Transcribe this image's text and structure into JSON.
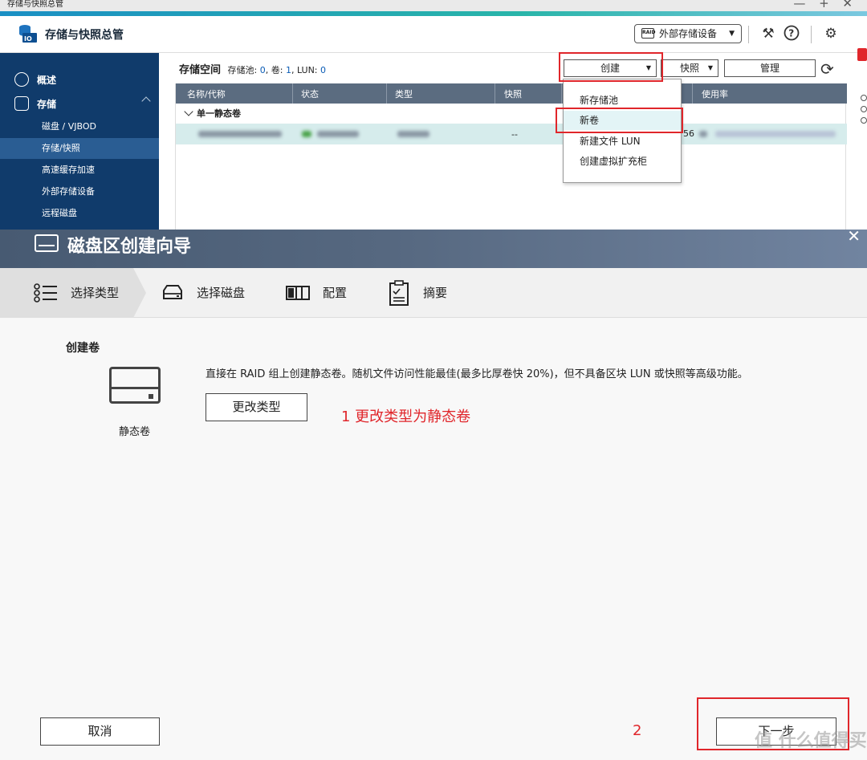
{
  "window": {
    "title": "存储与快照总管",
    "controls": "—  +  ✕"
  },
  "app": {
    "title": "存储与快照总管",
    "external_devices_label": "外部存储设备",
    "raid_badge": "RAID",
    "icons": [
      "tools-icon",
      "help-icon",
      "settings-icon"
    ]
  },
  "sidebar": {
    "sections": [
      {
        "label": "概述",
        "icon": "dashboard-icon"
      },
      {
        "label": "存储",
        "icon": "storage-icon"
      }
    ],
    "items": [
      {
        "label": "磁盘 / VJBOD",
        "active": false
      },
      {
        "label": "存储/快照",
        "active": true
      },
      {
        "label": "高速缓存加速",
        "active": false
      },
      {
        "label": "外部存储设备",
        "active": false
      },
      {
        "label": "远程磁盘",
        "active": false
      }
    ]
  },
  "content": {
    "title": "存储空间",
    "meta_prefix": "存储池: ",
    "pool_count": "0",
    "meta_vol": ", 卷: ",
    "vol_count": "1",
    "meta_lun": ", LUN: ",
    "lun_count": "0",
    "toolbar": {
      "create": "创建",
      "snapshot": "快照",
      "manage": "管理"
    },
    "columns": [
      "名称/代称",
      "状态",
      "类型",
      "快照",
      "",
      "使用率"
    ],
    "group_label": "单一静态卷",
    "row": {
      "snapshot": "--",
      "partial_capacity": "56"
    }
  },
  "create_menu": {
    "items": [
      "新存储池",
      "新卷",
      "新建文件 LUN",
      "创建虚拟扩充柜"
    ],
    "highlighted": 1
  },
  "wizard": {
    "title": "磁盘区创建向导",
    "steps": [
      "选择类型",
      "选择磁盘",
      "配置",
      "摘要"
    ],
    "active_step": 0,
    "section_label": "创建卷",
    "volume_type": "静态卷",
    "description": "直接在 RAID 组上创建静态卷。随机文件访问性能最佳(最多比厚卷快 20%)，但不具备区块 LUN 或快照等高级功能。",
    "change_type_button": "更改类型",
    "cancel_button": "取消",
    "next_button": "下一步"
  },
  "annotations": {
    "step1": "1 更改类型为静态卷",
    "step2": "2"
  },
  "watermark": "值 什么值得买",
  "colors": {
    "sidebar_bg": "#103b6b",
    "sidebar_active": "#2a5d93",
    "table_header": "#5b6c80",
    "selected_row": "#d6ecec",
    "annotation_red": "#e0262b",
    "link_blue": "#0b5cb5"
  }
}
